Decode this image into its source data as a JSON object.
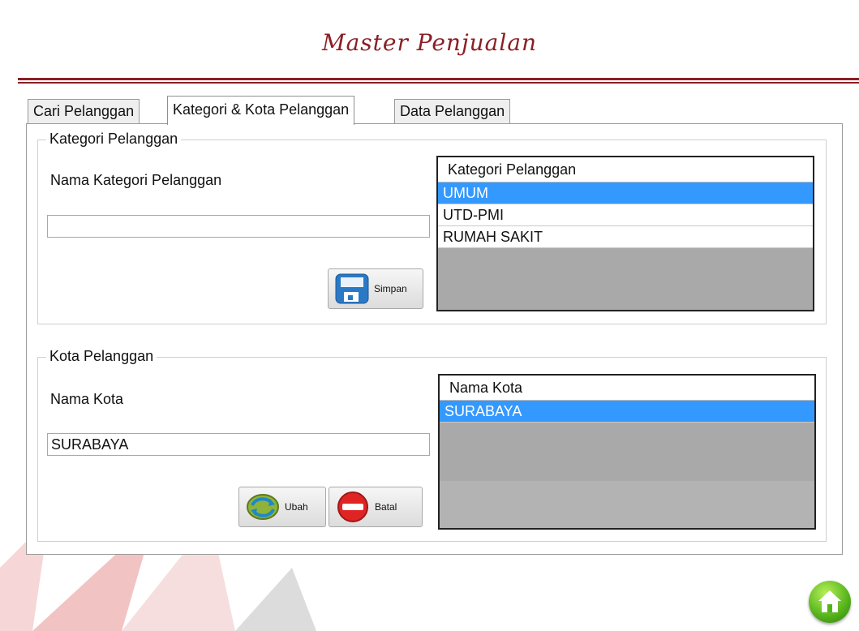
{
  "page": {
    "title": "Master Penjualan"
  },
  "tabs": [
    {
      "label": "Cari Pelanggan"
    },
    {
      "label": "Kategori & Kota Pelanggan"
    },
    {
      "label": "Data Pelanggan"
    }
  ],
  "kategori": {
    "group_label": "Kategori Pelanggan",
    "field_label": "Nama Kategori Pelanggan",
    "field_value": "",
    "save_label": "Simpan",
    "list_header": "Kategori Pelanggan",
    "items": [
      "UMUM",
      "UTD-PMI",
      "RUMAH SAKIT"
    ],
    "selected_index": 0
  },
  "kota": {
    "group_label": "Kota Pelanggan",
    "field_label": "Nama Kota",
    "field_value": "SURABAYA",
    "edit_label": "Ubah",
    "cancel_label": "Batal",
    "list_header": "Nama Kota",
    "items": [
      "SURABAYA"
    ],
    "selected_index": 0
  },
  "colors": {
    "title": "#8a1f24",
    "selection": "#3399ff",
    "list_background": "#a9a9a9"
  },
  "icons": {
    "save": "floppy-disk-icon",
    "edit": "refresh-arrows-icon",
    "cancel": "no-entry-icon",
    "home": "home-icon"
  }
}
